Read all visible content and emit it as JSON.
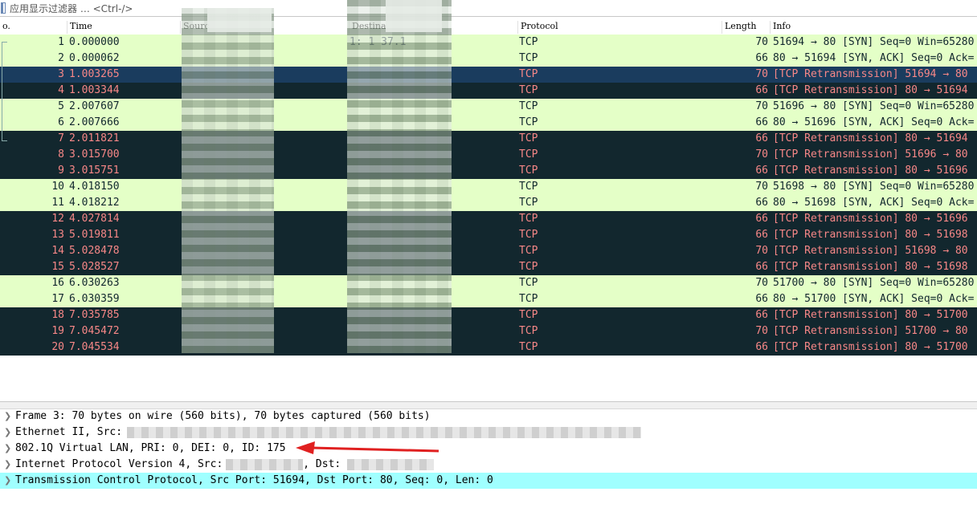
{
  "filter": {
    "placeholder": "应用显示过滤器 … <Ctrl-/>"
  },
  "columns": {
    "no": "o.",
    "time": "Time",
    "source": "Sourc",
    "destination": "Destina",
    "protocol": "Protocol",
    "length": "Length",
    "info": "Info"
  },
  "packets": [
    {
      "no": "1",
      "time": "0.000000",
      "dst": "1:    1    37.1",
      "proto": "TCP",
      "len": "70",
      "info": "51694 → 80 [SYN] Seq=0 Win=65280",
      "kind": "syn"
    },
    {
      "no": "2",
      "time": "0.000062",
      "dst": "",
      "proto": "TCP",
      "len": "66",
      "info": "80 → 51694 [SYN, ACK] Seq=0 Ack=",
      "kind": "syn"
    },
    {
      "no": "3",
      "time": "1.003265",
      "dst": "",
      "proto": "TCP",
      "len": "70",
      "info": "[TCP Retransmission] 51694 → 80",
      "kind": "sel"
    },
    {
      "no": "4",
      "time": "1.003344",
      "dst": "",
      "proto": "TCP",
      "len": "66",
      "info": "[TCP Retransmission] 80 → 51694",
      "kind": "rtx"
    },
    {
      "no": "5",
      "time": "2.007607",
      "dst": "",
      "proto": "TCP",
      "len": "70",
      "info": "51696 → 80 [SYN] Seq=0 Win=65280",
      "kind": "syn"
    },
    {
      "no": "6",
      "time": "2.007666",
      "dst": "",
      "proto": "TCP",
      "len": "66",
      "info": "80 → 51696 [SYN, ACK] Seq=0 Ack=",
      "kind": "syn"
    },
    {
      "no": "7",
      "time": "2.011821",
      "dst": "",
      "proto": "TCP",
      "len": "66",
      "info": "[TCP Retransmission] 80 → 51694",
      "kind": "rtx"
    },
    {
      "no": "8",
      "time": "3.015700",
      "dst": "",
      "proto": "TCP",
      "len": "70",
      "info": "[TCP Retransmission] 51696 → 80",
      "kind": "rtx"
    },
    {
      "no": "9",
      "time": "3.015751",
      "dst": "",
      "proto": "TCP",
      "len": "66",
      "info": "[TCP Retransmission] 80 → 51696",
      "kind": "rtx"
    },
    {
      "no": "10",
      "time": "4.018150",
      "dst": "",
      "proto": "TCP",
      "len": "70",
      "info": "51698 → 80 [SYN] Seq=0 Win=65280",
      "kind": "syn"
    },
    {
      "no": "11",
      "time": "4.018212",
      "dst": "",
      "proto": "TCP",
      "len": "66",
      "info": "80 → 51698 [SYN, ACK] Seq=0 Ack=",
      "kind": "syn"
    },
    {
      "no": "12",
      "time": "4.027814",
      "dst": "",
      "proto": "TCP",
      "len": "66",
      "info": "[TCP Retransmission] 80 → 51696",
      "kind": "rtx"
    },
    {
      "no": "13",
      "time": "5.019811",
      "dst": "",
      "proto": "TCP",
      "len": "66",
      "info": "[TCP Retransmission] 80 → 51698",
      "kind": "rtx"
    },
    {
      "no": "14",
      "time": "5.028478",
      "dst": "",
      "proto": "TCP",
      "len": "70",
      "info": "[TCP Retransmission] 51698 → 80",
      "kind": "rtx"
    },
    {
      "no": "15",
      "time": "5.028527",
      "dst": "",
      "proto": "TCP",
      "len": "66",
      "info": "[TCP Retransmission] 80 → 51698",
      "kind": "rtx"
    },
    {
      "no": "16",
      "time": "6.030263",
      "dst": "",
      "proto": "TCP",
      "len": "70",
      "info": "51700 → 80 [SYN] Seq=0 Win=65280",
      "kind": "syn"
    },
    {
      "no": "17",
      "time": "6.030359",
      "dst": "",
      "proto": "TCP",
      "len": "66",
      "info": "80 → 51700 [SYN, ACK] Seq=0 Ack=",
      "kind": "syn"
    },
    {
      "no": "18",
      "time": "7.035785",
      "dst": "",
      "proto": "TCP",
      "len": "66",
      "info": "[TCP Retransmission] 80 → 51700",
      "kind": "rtx"
    },
    {
      "no": "19",
      "time": "7.045472",
      "dst": "",
      "proto": "TCP",
      "len": "70",
      "info": "[TCP Retransmission] 51700 → 80",
      "kind": "rtx"
    },
    {
      "no": "20",
      "time": "7.045534",
      "dst": "",
      "proto": "TCP",
      "len": "66",
      "info": "[TCP Retransmission] 80 → 51700",
      "kind": "rtx"
    }
  ],
  "details": {
    "frame": "Frame 3: 70 bytes on wire (560 bits), 70 bytes captured (560 bits)",
    "ethernet": "Ethernet II, Src:",
    "vlan": "802.1Q Virtual LAN, PRI: 0, DEI: 0, ID: 175",
    "ip_prefix": "Internet Protocol Version 4, Src:",
    "ip_dst": ", Dst:",
    "tcp": "Transmission Control Protocol, Src Port: 51694, Dst Port: 80, Seq: 0, Len: 0"
  },
  "colors": {
    "syn_bg": "#e4ffc7",
    "rtx_bg": "#12272e",
    "rtx_fg": "#f78787",
    "selected_detail_bg": "#a0ffff",
    "annotation_arrow": "#e02020"
  },
  "icons": {
    "expand": "chevron-right-icon"
  }
}
